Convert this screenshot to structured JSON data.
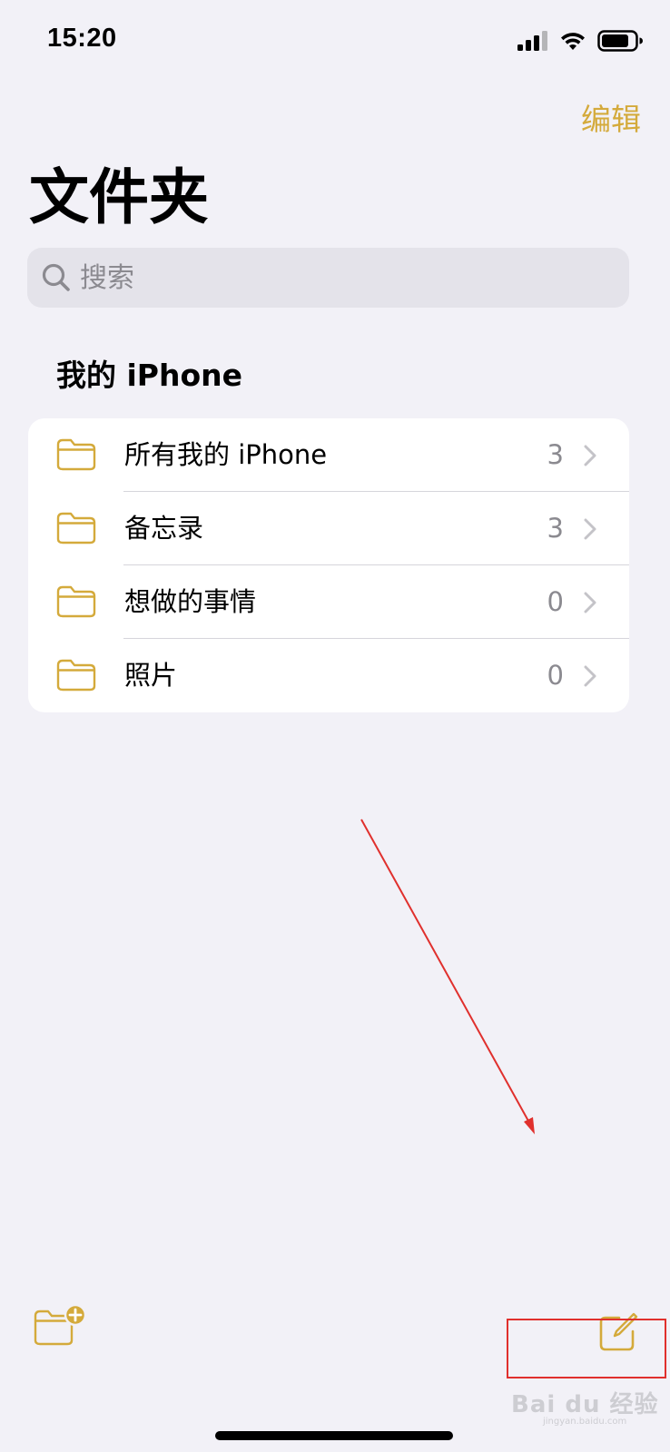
{
  "status_bar": {
    "time": "15:20"
  },
  "nav": {
    "edit_label": "编辑",
    "title": "文件夹"
  },
  "search": {
    "placeholder": "搜索"
  },
  "section": {
    "header": "我的 iPhone",
    "folders": [
      {
        "name": "所有我的 iPhone",
        "count": "3",
        "icon": "folder-icon"
      },
      {
        "name": "备忘录",
        "count": "3",
        "icon": "folder-icon"
      },
      {
        "name": "想做的事情",
        "count": "0",
        "icon": "folder-icon"
      },
      {
        "name": "照片",
        "count": "0",
        "icon": "folder-icon"
      }
    ]
  },
  "toolbar": {
    "new_folder_icon": "folder-plus-icon",
    "compose_icon": "compose-icon"
  },
  "watermark": {
    "text": "Bai du 经验",
    "sub": "jingyan.baidu.com"
  },
  "colors": {
    "accent": "#d4aa3b",
    "background": "#f2f1f7",
    "annotation": "#e0302d"
  }
}
